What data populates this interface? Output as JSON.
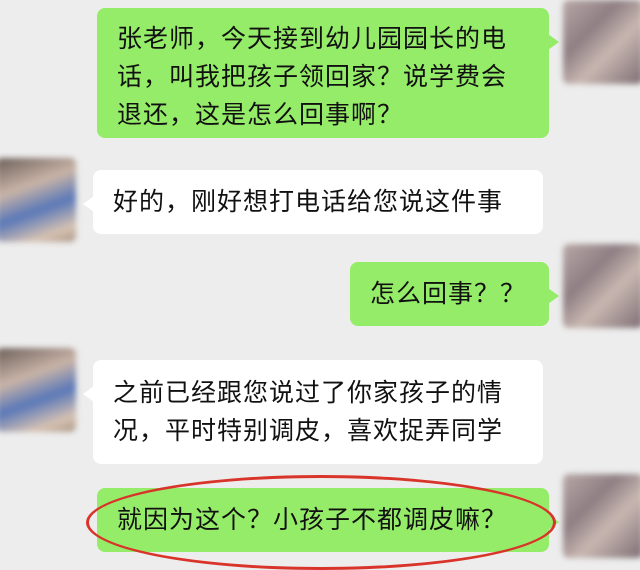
{
  "messages": [
    {
      "side": "out",
      "text": "张老师，今天接到幼儿园园长的电\n话，叫我把孩子领回家？说学费会\n退还，这是怎么回事啊？"
    },
    {
      "side": "in",
      "text": "好的，刚好想打电话给您说这件事"
    },
    {
      "side": "out",
      "text": "怎么回事？？"
    },
    {
      "side": "in",
      "text": "之前已经跟您说过了你家孩子的情\n况，平时特别调皮，喜欢捉弄同学"
    },
    {
      "side": "out",
      "text": "就因为这个？小孩子不都调皮嘛？"
    }
  ],
  "colors": {
    "background": "#ededed",
    "outgoing_bubble": "#95ec69",
    "incoming_bubble": "#ffffff",
    "annotation_circle": "#d9342a"
  }
}
